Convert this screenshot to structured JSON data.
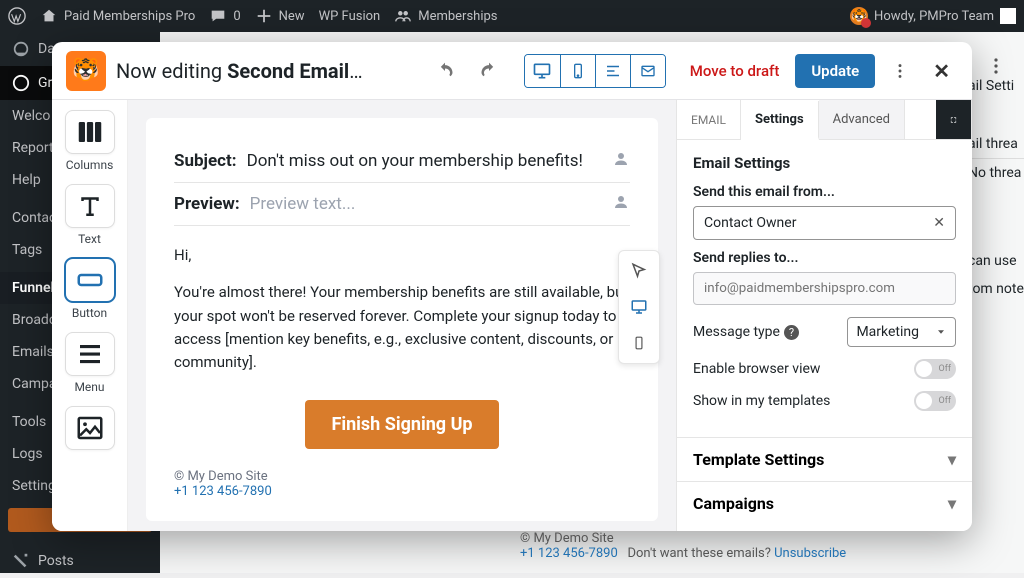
{
  "adminbar": {
    "site": "Paid Memberships Pro",
    "comments": "0",
    "new": "New",
    "wpfusion": "WP Fusion",
    "memberships": "Memberships",
    "howdy": "Howdy, PMPro Team"
  },
  "wp_sidebar": {
    "items": [
      "Da",
      "Gr",
      "Welco",
      "Report",
      "Help",
      "Contac",
      "Tags",
      "Funnel",
      "Broadc",
      "Emails",
      "Campa",
      "Tools",
      "Logs",
      "Setting"
    ],
    "posts": "Posts"
  },
  "bg_peek": {
    "a": "ail Setti",
    "b": "ail threa",
    "c": "No threa",
    "d": "can use",
    "e": "tom note"
  },
  "editor": {
    "now_editing_prefix": "Now editing ",
    "title_bold": "Second Email: A...",
    "move_to_draft": "Move to draft",
    "update": "Update"
  },
  "palette": {
    "columns": "Columns",
    "text": "Text",
    "button": "Button",
    "menu": "Menu"
  },
  "email": {
    "subject_label": "Subject:",
    "subject_value": "Don't miss out on your membership benefits!",
    "preview_label": "Preview:",
    "preview_placeholder": "Preview text...",
    "greeting": "Hi,",
    "body": "You're almost there! Your membership benefits are still available, but your spot won't be reserved forever. Complete your signup today to access [mention key benefits, e.g., exclusive content, discounts, or community].",
    "cta": "Finish Signing Up",
    "footer_copyright": "© My Demo Site",
    "footer_phone": "+1 123 456-7890"
  },
  "settings": {
    "tab_email": "EMAIL",
    "tab_settings": "Settings",
    "tab_advanced": "Advanced",
    "heading": "Email Settings",
    "send_from_label": "Send this email from...",
    "send_from_value": "Contact Owner",
    "replies_label": "Send replies to...",
    "replies_placeholder": "info@paidmembershipspro.com",
    "message_type_label": "Message type",
    "message_type_value": "Marketing",
    "browser_view": "Enable browser view",
    "show_templates": "Show in my templates",
    "toggle_off": "Off",
    "template_settings": "Template Settings",
    "campaigns": "Campaigns"
  },
  "page_bottom": {
    "copyright": "© My Demo Site",
    "phone": "+1 123 456-7890",
    "unsub_pre": "Don't want these emails? ",
    "unsub": "Unsubscribe"
  }
}
